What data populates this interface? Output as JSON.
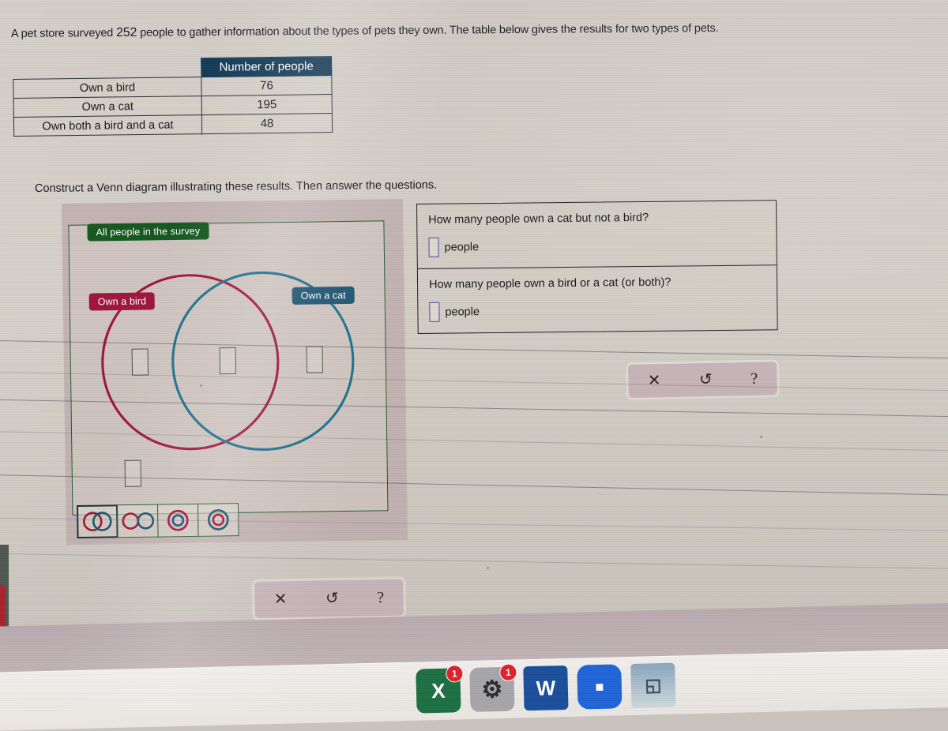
{
  "problem": {
    "intro_before_number": "A pet store surveyed ",
    "survey_count": "252",
    "intro_after_number": " people to gather information about the types of pets they own. The table below gives the results for two types of pets.",
    "instruction": "Construct a Venn diagram illustrating these results. Then answer the questions."
  },
  "table": {
    "corner": "",
    "header": "Number of people",
    "rows": [
      {
        "label": "Own a bird",
        "value": "76"
      },
      {
        "label": "Own a cat",
        "value": "195"
      },
      {
        "label": "Own both a bird and a cat",
        "value": "48"
      }
    ]
  },
  "venn": {
    "universe_label": "All people in the survey",
    "left_set_label": "Own a bird",
    "right_set_label": "Own a cat",
    "region_values": {
      "bird_only": "",
      "both": "",
      "cat_only": "",
      "neither": ""
    },
    "colors": {
      "universe": "#15571f",
      "bird": "#9e153b",
      "cat": "#1b5270",
      "panel_bg": "#beaaac",
      "box_border": "#4d4a50"
    },
    "palette": [
      {
        "name": "overlapping-circles",
        "selected": true
      },
      {
        "name": "disjoint-circles",
        "selected": false
      },
      {
        "name": "cat-inside-bird",
        "selected": false
      },
      {
        "name": "bird-inside-cat",
        "selected": false
      }
    ]
  },
  "questions": [
    {
      "text": "How many people own a cat but not a bird?",
      "answer_value": "",
      "answer_placeholder": "",
      "unit": "people"
    },
    {
      "text": "How many people own a bird or a cat (or both)?",
      "answer_value": "",
      "answer_placeholder": "",
      "unit": "people"
    }
  ],
  "toolbars": {
    "venn": [
      {
        "name": "clear-button",
        "glyph": "✕"
      },
      {
        "name": "undo-button",
        "glyph": "↺"
      },
      {
        "name": "help-button",
        "glyph": "?"
      }
    ],
    "questions": [
      {
        "name": "clear-button",
        "glyph": "✕"
      },
      {
        "name": "undo-button",
        "glyph": "↺"
      },
      {
        "name": "help-button",
        "glyph": "?"
      }
    ]
  },
  "dock": [
    {
      "name": "excel",
      "glyph": "X",
      "color": "#1d6f42",
      "badge": "1"
    },
    {
      "name": "system-preferences",
      "glyph": "⚙",
      "color": "#8e8e93",
      "badge": "1"
    },
    {
      "name": "word",
      "glyph": "W",
      "color": "#1b4f9c",
      "badge": ""
    },
    {
      "name": "zoom",
      "glyph": "■",
      "color": "#2064d8",
      "badge": ""
    },
    {
      "name": "preview",
      "glyph": "◱",
      "color": "#6b8fae",
      "badge": ""
    }
  ]
}
